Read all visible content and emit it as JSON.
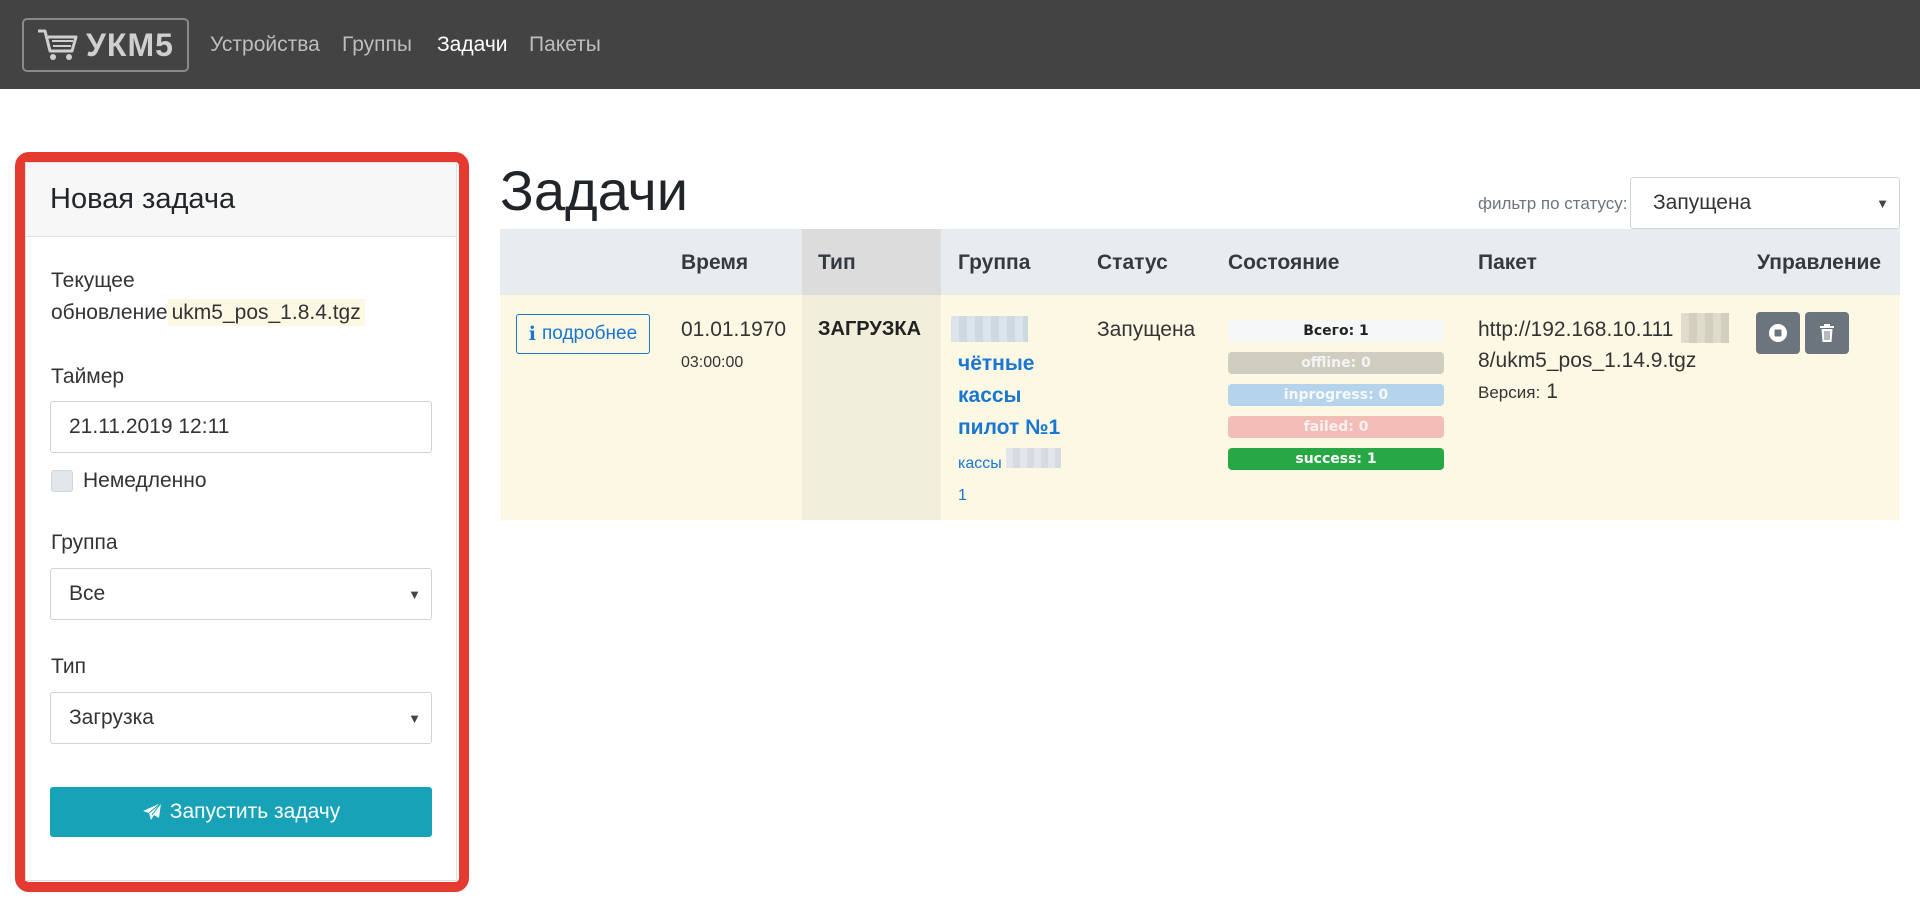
{
  "navbar": {
    "brand": "УКМ5",
    "items": [
      {
        "label": "Устройства",
        "active": false
      },
      {
        "label": "Группы",
        "active": false
      },
      {
        "label": "Задачи",
        "active": true
      },
      {
        "label": "Пакеты",
        "active": false
      }
    ]
  },
  "new_task": {
    "title": "Новая задача",
    "current_update_label_1": "Текущее",
    "current_update_label_2": "обновление",
    "current_update_value": "ukm5_pos_1.8.4.tgz",
    "timer_label": "Таймер",
    "timer_value": "21.11.2019 12:11",
    "immediate_label": "Немедленно",
    "immediate_checked": false,
    "group_label": "Группа",
    "group_value": "Все",
    "type_label": "Тип",
    "type_value": "Загрузка",
    "submit_label": "Запустить задачу"
  },
  "tasks": {
    "title": "Задачи",
    "filter_label": "фильтр по статусу:",
    "filter_value": "Запущена",
    "columns": [
      "Время",
      "Тип",
      "Группа",
      "Статус",
      "Состояние",
      "Пакет",
      "Управление"
    ],
    "rows": [
      {
        "details_label": "подробнее",
        "date": "01.01.1970",
        "time": "03:00:00",
        "type": "ЗАГРУЗКА",
        "group_line1": "чётные",
        "group_line2": "кассы",
        "group_line3": "пилот №1",
        "group_sub1": "кассы",
        "group_sub2": "1",
        "status": "Запущена",
        "state": {
          "total": "Всего: 1",
          "offline": "offline: 0",
          "inprogress": "inprogress: 0",
          "failed": "failed: 0",
          "success": "success: 1"
        },
        "package_url_1": "http://192.168.10.111",
        "package_url_2": "8/ukm5_pos_1.14.9.tgz",
        "version_label": "Версия:",
        "version_value": "1"
      }
    ]
  },
  "colors": {
    "navbar_bg": "#434343",
    "highlight_border": "#e53a2f",
    "primary_link": "#1976d2",
    "submit_bg": "#17a2b8",
    "success": "#28a745",
    "row_bg": "#fdf8e4"
  },
  "icons": {
    "brand": "shopping-cart-icon",
    "details": "info-icon",
    "submit": "paper-plane-icon",
    "stop": "stop-circle-icon",
    "delete": "trash-icon"
  }
}
